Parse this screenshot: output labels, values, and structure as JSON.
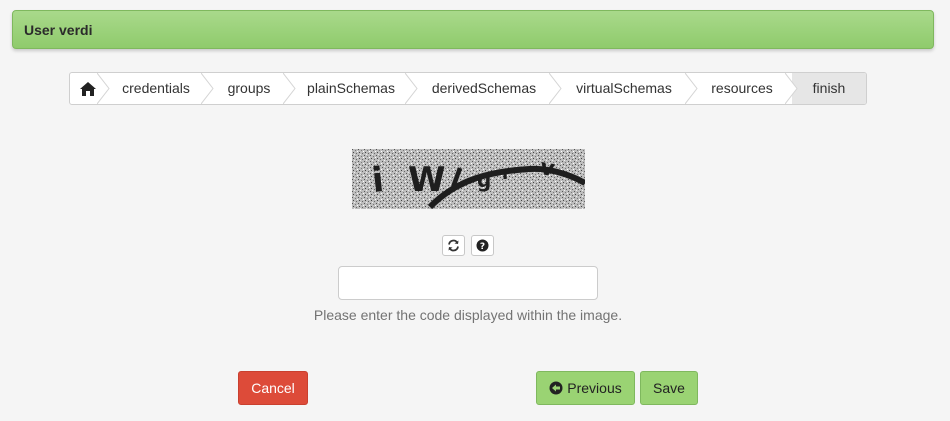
{
  "header": {
    "title": "User verdi"
  },
  "wizard": {
    "home_icon": "home-icon",
    "steps": [
      {
        "label": "credentials"
      },
      {
        "label": "groups"
      },
      {
        "label": "plainSchemas"
      },
      {
        "label": "derivedSchemas"
      },
      {
        "label": "virtualSchemas"
      },
      {
        "label": "resources"
      },
      {
        "label": "finish"
      }
    ],
    "active_step": "finish"
  },
  "captcha": {
    "refresh_icon": "refresh-icon",
    "help_icon": "question-circle-icon"
  },
  "code_input": {
    "value": "",
    "placeholder": ""
  },
  "help_text": "Please enter the code displayed within the image.",
  "buttons": {
    "cancel": "Cancel",
    "previous": "Previous",
    "previous_icon": "arrow-circle-left-icon",
    "save": "Save"
  },
  "colors": {
    "header": "#9ad373",
    "cancel": "#dd4b39",
    "primary": "#9ad373"
  }
}
